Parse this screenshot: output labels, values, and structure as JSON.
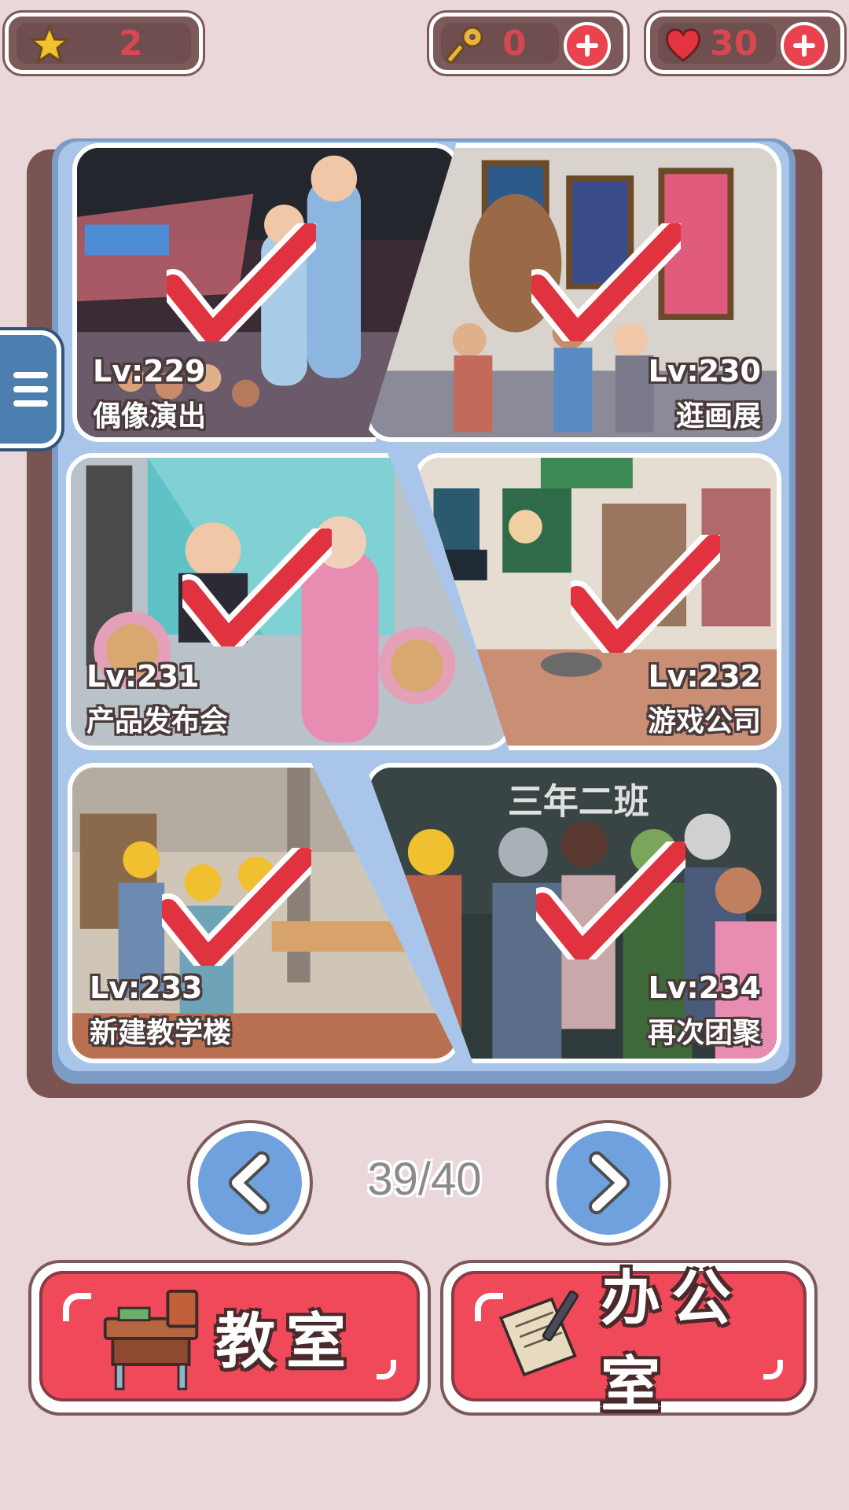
{
  "status_bar": {
    "stars": "2",
    "keys": "0",
    "hearts": "30"
  },
  "levels": [
    {
      "level": "Lv:229",
      "name": "偶像演出"
    },
    {
      "level": "Lv:230",
      "name": "逛画展"
    },
    {
      "level": "Lv:231",
      "name": "产品发布会"
    },
    {
      "level": "Lv:232",
      "name": "游戏公司"
    },
    {
      "level": "Lv:233",
      "name": "新建教学楼"
    },
    {
      "level": "Lv:234",
      "name": "再次团聚"
    }
  ],
  "pager": {
    "current": "39/40"
  },
  "buttons": {
    "classroom": "教室",
    "office": "办公室"
  },
  "colors": {
    "background": "#ead7d9",
    "album_blue": "#a9c6ea",
    "accent_red": "#f0495a",
    "check_red": "#e0333f",
    "nav_blue": "#6ea1dd"
  },
  "icons": [
    "star-icon",
    "key-icon",
    "heart-icon",
    "plus-icon",
    "menu-icon",
    "checkmark-icon",
    "chevron-left-icon",
    "chevron-right-icon",
    "desk-icon",
    "notepad-pen-icon"
  ]
}
